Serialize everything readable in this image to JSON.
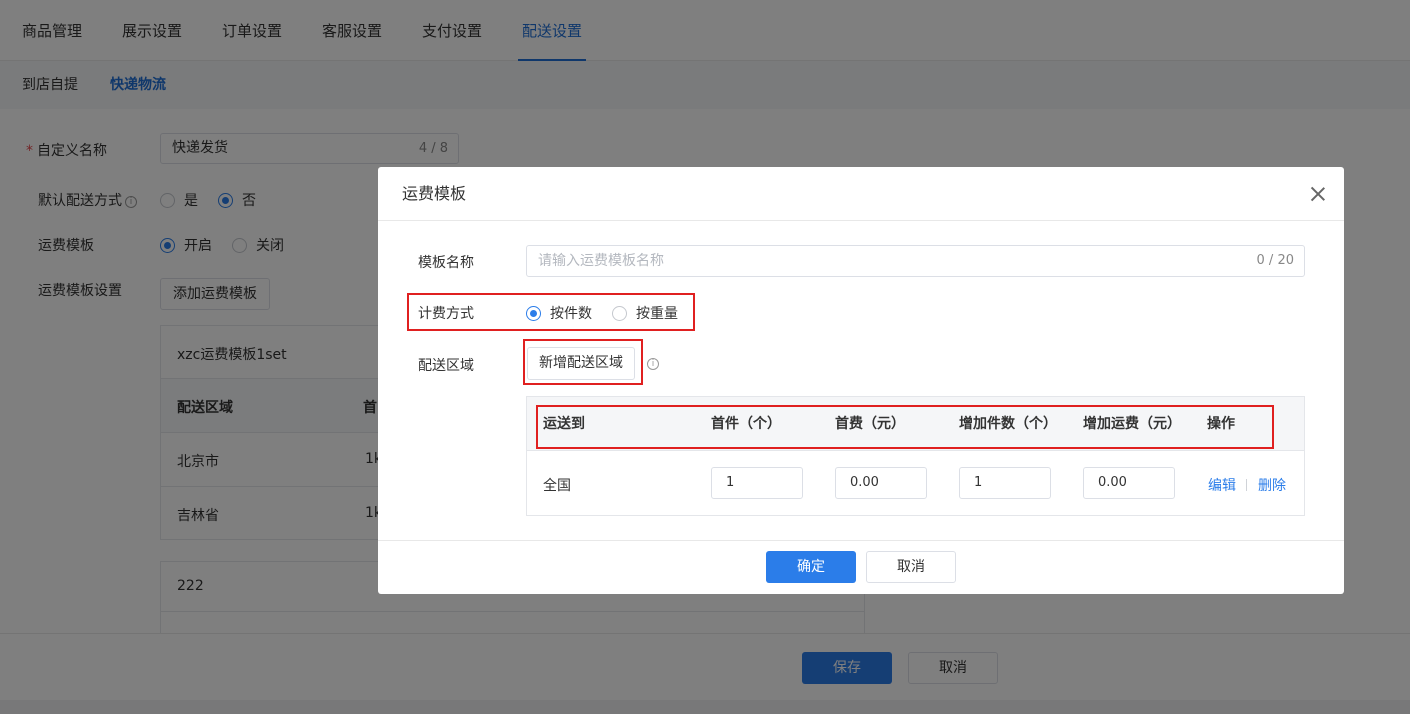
{
  "nav": {
    "tabs": [
      "商品管理",
      "展示设置",
      "订单设置",
      "客服设置",
      "支付设置",
      "配送设置"
    ],
    "active_tab": "配送设置",
    "subtabs": [
      "到店自提",
      "快递物流"
    ],
    "active_subtab": "快递物流"
  },
  "form": {
    "custom_name_label": "自定义名称",
    "custom_name_value": "快递发货",
    "custom_name_count": "4 / 8",
    "default_method_label": "默认配送方式",
    "default_yes": "是",
    "default_no": "否",
    "fee_template_label": "运费模板",
    "fee_on": "开启",
    "fee_off": "关闭",
    "fee_settings_label": "运费模板设置",
    "add_template_button": "添加运费模板"
  },
  "templates": [
    {
      "name": "xzc运费模板1set",
      "header_area": "配送区域",
      "header_partial": "首",
      "rows": [
        {
          "area": "北京市",
          "partial": "1k"
        },
        {
          "area": "吉林省",
          "partial": "1k"
        }
      ]
    },
    {
      "name": "222"
    }
  ],
  "footer": {
    "save": "保存",
    "cancel": "取消"
  },
  "modal": {
    "title": "运费模板",
    "name_label": "模板名称",
    "name_placeholder": "请输入运费模板名称",
    "name_count": "0 / 20",
    "billing_label": "计费方式",
    "billing_by_count": "按件数",
    "billing_by_weight": "按重量",
    "billing_selected": "按件数",
    "area_label": "配送区域",
    "add_area_button": "新增配送区域",
    "table": {
      "headers": [
        "运送到",
        "首件（个）",
        "首费（元）",
        "增加件数（个）",
        "增加运费（元）",
        "操作"
      ],
      "rows": [
        {
          "dest": "全国",
          "first_items": "1",
          "first_fee": "0.00",
          "extra_items": "1",
          "extra_fee": "0.00",
          "edit": "编辑",
          "delete": "删除"
        }
      ]
    },
    "confirm": "确定",
    "cancel": "取消"
  },
  "colors": {
    "accent": "#2b7de9",
    "highlight_box": "#e02020"
  }
}
